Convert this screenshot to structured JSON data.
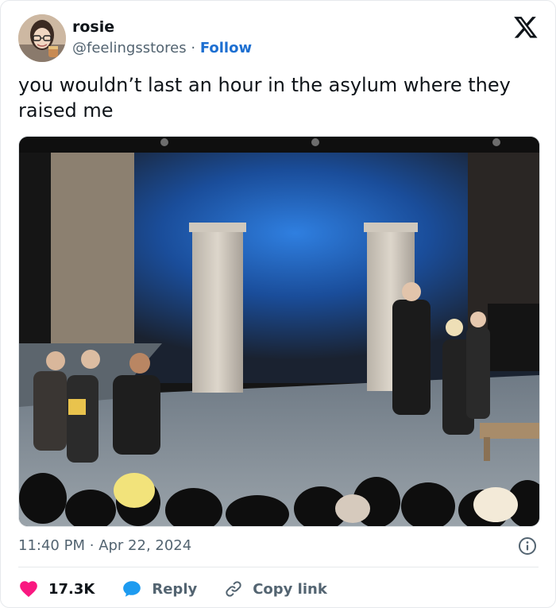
{
  "author": {
    "name": "rosie",
    "handle": "@feelingsstores",
    "separator": "·",
    "follow_label": "Follow"
  },
  "tweet": {
    "text": "you wouldn’t last an hour in the asylum where they raised me",
    "time": "11:40 PM",
    "dot": "·",
    "date": "Apr 22, 2024"
  },
  "actions": {
    "likes": "17.3K",
    "reply_label": "Reply",
    "copy_label": "Copy link"
  },
  "icons": {
    "logo": "x-logo-icon",
    "info": "info-icon",
    "like": "heart-icon",
    "reply": "speech-bubble-icon",
    "copy": "link-icon"
  },
  "colors": {
    "accent": "#1d6fd1",
    "like": "#f91880",
    "reply": "#1d9bf0",
    "muted": "#536471"
  }
}
